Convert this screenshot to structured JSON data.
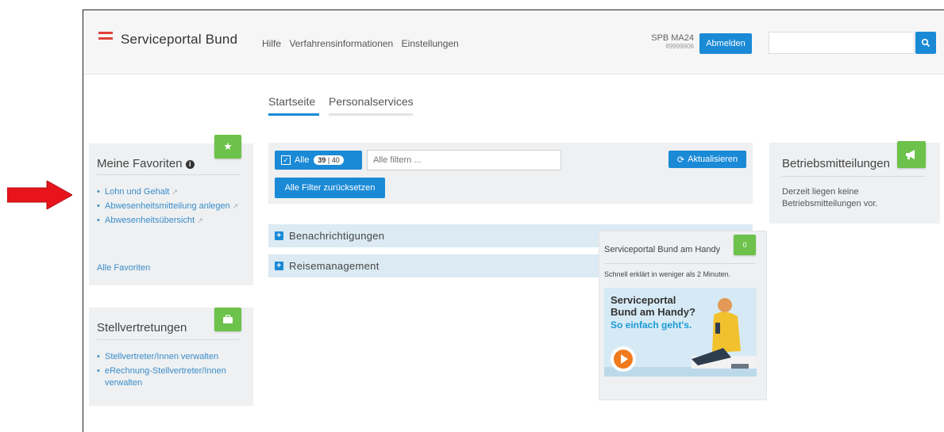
{
  "brand": {
    "name": "Serviceportal Bund"
  },
  "nav": [
    "Hilfe",
    "Verfahrensinformationen",
    "Einstellungen"
  ],
  "user": {
    "name": "SPB MA24",
    "id": "89999906",
    "logout_label": "Abmelden"
  },
  "search": {
    "placeholder": ""
  },
  "tabs": [
    {
      "label": "Startseite",
      "active": true
    },
    {
      "label": "Personalservices",
      "active": false
    }
  ],
  "favorites": {
    "title": "Meine Favoriten",
    "items": [
      "Lohn und Gehalt",
      "Abwesenheitsmitteilung anlegen",
      "Abwesenheitsübersicht"
    ],
    "all_label": "Alle Favoriten"
  },
  "stellvertretungen": {
    "title": "Stellvertretungen",
    "items": [
      "Stellvertreter/Innen verwalten",
      "eRechnung-Stellvertreter/Innen verwalten"
    ]
  },
  "filter": {
    "all_label": "Alle",
    "count_selected": "39",
    "count_total": "40",
    "input_placeholder": "Alle filtern ...",
    "reset_label": "Alle Filter zurücksetzen",
    "refresh_label": "Aktualisieren"
  },
  "accordion": [
    {
      "label": "Benachrichtigungen"
    },
    {
      "label": "Reisemanagement"
    }
  ],
  "handy_widget": {
    "title": "Serviceportal Bund am Handy",
    "badge": "0",
    "subtitle": "Schnell erklärt in weniger als 2 Minuten.",
    "promo_line1": "Serviceportal",
    "promo_line2": "Bund am Handy?",
    "promo_line3": "So einfach geht's."
  },
  "betriebsmitteilungen": {
    "title": "Betriebsmitteilungen",
    "text": "Derzeit liegen keine Betriebsmitteilungen vor."
  },
  "colors": {
    "accent": "#1a8ad6",
    "green": "#6cc24a",
    "brand_red": "#e0413a",
    "arrow_red": "#e8141b"
  }
}
